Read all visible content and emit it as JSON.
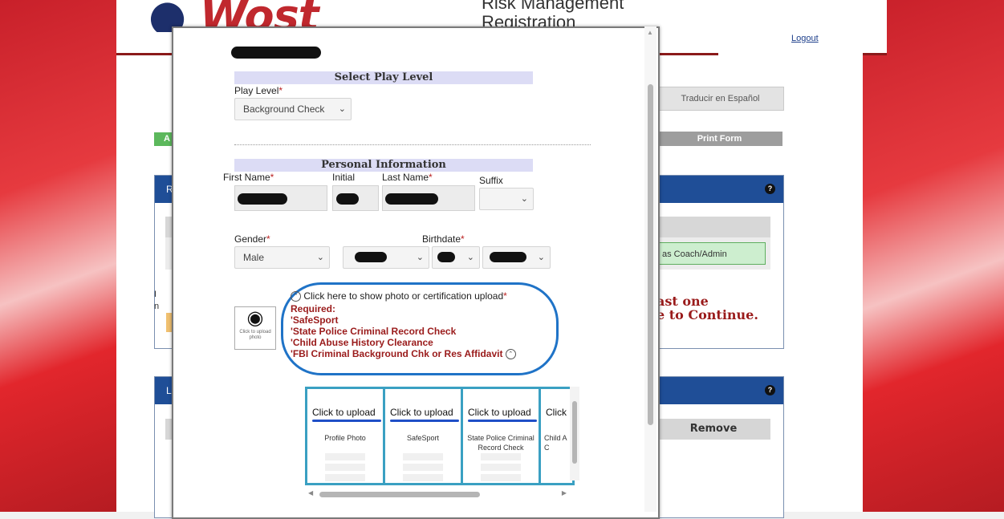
{
  "site": {
    "logo_text": "Wost",
    "title": "Risk Management Registration",
    "logout": "Logout"
  },
  "background_page": {
    "translate_button": "Traducir en Español",
    "print_button": "Print Form",
    "green_chip": "A",
    "panel1_letter": "R",
    "panel2_letter": "L",
    "coach_button": "as Coach/Admin",
    "warning": "ast one\ne to Continue.",
    "remove_header": "Remove",
    "side_letters": "I\nn"
  },
  "modal": {
    "section_play": "Select Play Level",
    "play_level_label": "Play Level",
    "play_level_value": "Background Check",
    "section_personal": "Personal Information",
    "first_name_label": "First Name",
    "initial_label": "Initial",
    "last_name_label": "Last Name",
    "suffix_label": "Suffix",
    "gender_label": "Gender",
    "gender_value": "Male",
    "birthdate_label": "Birthdate",
    "required_mark": "*",
    "photo_caption": "Click to upload photo",
    "show_upload_link": "Click here to show photo or certification upload",
    "required_heading": "Required:",
    "required_items": [
      "'SafeSport",
      "'State Police Criminal Record Check",
      "'Child Abuse History Clearance",
      "'FBI Criminal Background Chk or Res Affidavit"
    ],
    "uploads": [
      {
        "link": "Click to upload",
        "label": "Profile Photo"
      },
      {
        "link": "Click to upload",
        "label": "SafeSport"
      },
      {
        "link": "Click to upload",
        "label": "State Police Criminal Record Check"
      },
      {
        "link": "Click",
        "label": "Child A C"
      }
    ]
  },
  "icons": {
    "caret": "chevron-down-icon",
    "collapse": "collapse-icon",
    "help": "question-icon",
    "camera": "camera-icon"
  },
  "colors": {
    "brand_red": "#c0282e",
    "header_blue": "#1f4e97",
    "upload_border": "#3aa0c2",
    "oval": "#1f73c7",
    "required_text": "#9a1b1b"
  }
}
